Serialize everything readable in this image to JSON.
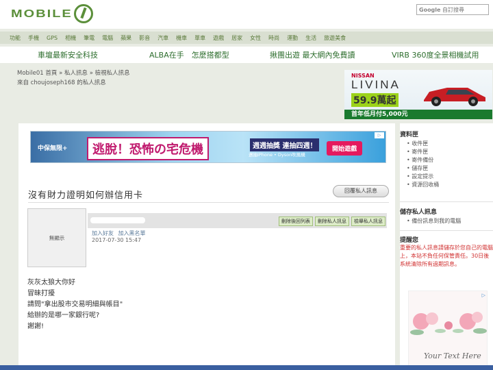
{
  "header": {
    "logo_text": "MOBILE",
    "search_brand": "Google",
    "search_placeholder": "自訂搜尋"
  },
  "nav": [
    "功能",
    "手機",
    "GPS",
    "相機",
    "筆電",
    "電腦",
    "蘋果",
    "影音",
    "汽車",
    "機車",
    "單車",
    "遊戲",
    "居家",
    "女性",
    "時尚",
    "運動",
    "生活",
    "旅遊美食"
  ],
  "promos": [
    "車壇最新安全科技",
    "ALBA在手　怎麼搭都型",
    "揪團出遊 最大網內免費讀",
    "VIRB 360度全景相機試用"
  ],
  "breadcrumb": {
    "home": "Mobile01 首頁",
    "sep": "»",
    "pm": "私人訊息",
    "view": "檢視私人訊息",
    "from": "來自 choujoseph168 的私人訊息"
  },
  "ads": {
    "nissan": {
      "brand": "NISSAN",
      "model": "LIVINA",
      "price": "59.9萬起",
      "monthly": "首年低月付5,000元"
    },
    "banner": {
      "left": "中保無限+",
      "headline": "逃脫！恐怖の宅危機",
      "campaign": "週週抽獎 連抽四週！",
      "prizes": "週抽iPhone • Dyson吹風機",
      "cta": "開始遊戲"
    },
    "flower_text": "Your Text Here"
  },
  "message": {
    "title": "沒有財力證明如何辦信用卡",
    "reply_button": "回覆私人訊息",
    "avatar_text": "無顯示",
    "actions": [
      "刪除後回列表",
      "刪除私人訊息",
      "檢舉私人訊息"
    ],
    "friend_link": "加入好友",
    "block_link": "加入黑名單",
    "time": "2017-07-30 15:47",
    "body": [
      "灰灰太狼大你好",
      "冒昧打擾",
      "請問\"拿出股市交易明細與帳目\"",
      "給辦的是哪一家銀行呢?",
      "謝謝!"
    ]
  },
  "sidebar": {
    "folders_title": "資料匣",
    "folders": [
      "收件匣",
      "寄件匣",
      "寄件備份",
      "儲存匣",
      "設定提示",
      "資源回收桶"
    ],
    "save_title": "儲存私人訊息",
    "save_items": [
      "備份訊息到我的電腦"
    ],
    "notice_title": "提醒您",
    "notice_text": "重要的私人訊息請儲存於您自己的電腦上，本站不負任何保管責任。30日後系統清除所有過期訊息。"
  }
}
